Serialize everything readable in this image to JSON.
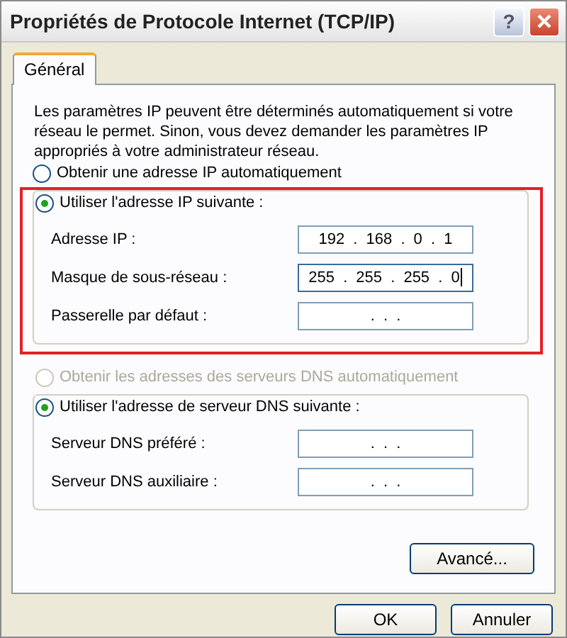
{
  "window": {
    "title": "Propriétés de Protocole Internet (TCP/IP)",
    "help_label": "?"
  },
  "tabs": [
    {
      "label": "Général",
      "selected": true
    }
  ],
  "description": "Les paramètres IP peuvent être déterminés automatiquement si votre réseau le permet. Sinon, vous devez demander les paramètres IP appropriés à votre administrateur réseau.",
  "sections": [
    {
      "highlighted": true,
      "auto_option": {
        "label": "Obtenir une adresse IP automatiquement",
        "selected": false,
        "disabled": false
      },
      "manual_option": {
        "label": "Utiliser l'adresse IP suivante :",
        "selected": true,
        "disabled": false
      },
      "fields": [
        {
          "label": "Adresse IP :",
          "value": "192 . 168 . 0 . 1",
          "focused": false
        },
        {
          "label": "Masque de sous-réseau :",
          "value": "255 . 255 . 255 . 0",
          "focused": true
        },
        {
          "label": "Passerelle par défaut :",
          "value": ". . .",
          "focused": false
        }
      ]
    },
    {
      "highlighted": false,
      "auto_option": {
        "label": "Obtenir les adresses des serveurs DNS automatiquement",
        "selected": false,
        "disabled": true
      },
      "manual_option": {
        "label": "Utiliser l'adresse de serveur DNS suivante :",
        "selected": true,
        "disabled": false
      },
      "fields": [
        {
          "label": "Serveur DNS préféré :",
          "value": ". . .",
          "focused": false
        },
        {
          "label": "Serveur DNS auxiliaire :",
          "value": ". . .",
          "focused": false
        }
      ]
    }
  ],
  "advanced_button": "Avancé...",
  "buttons": [
    "OK",
    "Annuler"
  ]
}
